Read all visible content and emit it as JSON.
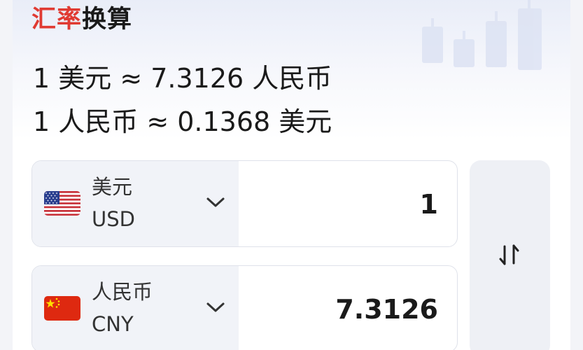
{
  "title": {
    "accent": "汇率",
    "rest": "换算"
  },
  "rates": [
    "1 美元 ≈ 7.3126 人民币",
    "1 人民币 ≈ 0.1368 美元"
  ],
  "from": {
    "name": "美元",
    "code": "USD",
    "amount": "1",
    "flag_icon": "us-flag-icon"
  },
  "to": {
    "name": "人民币",
    "code": "CNY",
    "amount": "7.3126",
    "flag_icon": "cn-flag-icon"
  },
  "swap_icon": "swap-arrows-icon",
  "colors": {
    "accent": "#e03a32",
    "panel": "#f1f3f8",
    "swap_bg": "#eef0f5"
  }
}
